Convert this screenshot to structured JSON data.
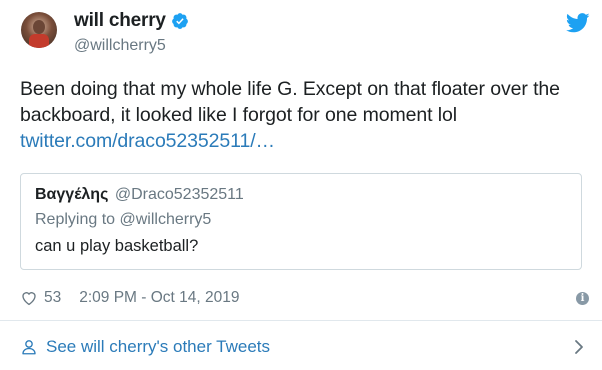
{
  "author": {
    "display_name": "will cherry",
    "handle": "@willcherry5"
  },
  "tweet": {
    "text": "Been doing that my whole life G. Except on that floater over the backboard, it looked like I forgot for one moment lol",
    "link": "twitter.com/draco52352511/…"
  },
  "quoted_tweet": {
    "display_name": "Βαγγέλης",
    "handle": "@Draco52352511",
    "replying_to": "Replying to @willcherry5",
    "text": "can u play basketball?"
  },
  "meta": {
    "likes": "53",
    "timestamp": "2:09 PM - Oct 14, 2019"
  },
  "footer": {
    "see_more_label": "See will cherry's other Tweets"
  },
  "colors": {
    "link": "#2b7bb9",
    "verified": "#1da1f2",
    "secondary_text": "#697882"
  },
  "icons": [
    "verified-badge-icon",
    "twitter-bird-icon",
    "heart-icon",
    "info-icon",
    "person-icon",
    "chevron-right-icon"
  ]
}
